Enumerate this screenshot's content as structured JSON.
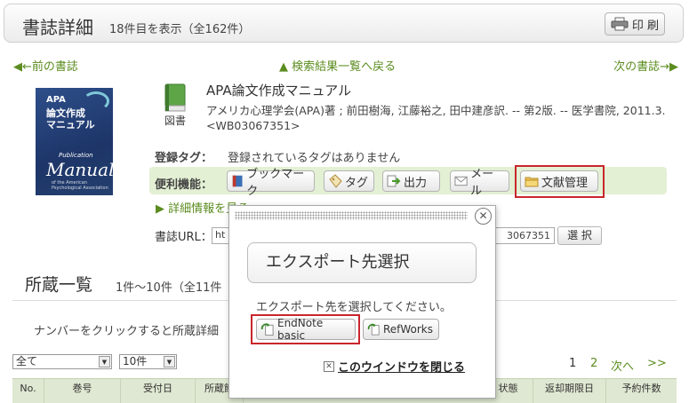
{
  "header": {
    "title": "書誌詳細",
    "count": "18件目を表示（全162件）",
    "print_label": "印 刷"
  },
  "nav": {
    "prev": "◀←前の書誌",
    "back": "▲ 検索結果一覧へ戻る",
    "next": "次の書誌→▶"
  },
  "cover": {
    "line1": "APA",
    "line2": "論文作成",
    "line3": "マニュアル",
    "line4": "Publication",
    "line5": "Manual",
    "line6": "of the American Psychological Association"
  },
  "book": {
    "type_label": "図書",
    "title": "APA論文作成マニュアル",
    "description": "アメリカ心理学会(APA)著 ; 前田樹海, 江藤裕之, 田中建彦訳. -- 第2版. -- 医学書院, 2011.3. <WB03067351>"
  },
  "tags": {
    "label": "登録タグ：",
    "value": "登録されているタグはありません"
  },
  "tools": {
    "label": "便利機能：",
    "bookmark": "ブックマーク",
    "tag": "タグ",
    "output": "出力",
    "mail": "メール",
    "refmgmt": "文献管理"
  },
  "detail_link": "▶ 詳細情報を見る",
  "url": {
    "label": "書誌URL：",
    "value_start": "ht",
    "value_end": "3067351",
    "select": "選 択"
  },
  "holdings": {
    "title": "所蔵一覧",
    "count": "1件～10件（全11件",
    "note": "ナンバーをクリックすると所蔵詳細"
  },
  "filters": {
    "scope": "全て",
    "per_page": "10件"
  },
  "pager": {
    "p1": "1",
    "p2": "2",
    "next": "次へ",
    "last": ">>"
  },
  "table": {
    "columns": [
      "No.",
      "巻号",
      "受付日",
      "所蔵館",
      "状態",
      "返却期限日",
      "予約件数"
    ]
  },
  "popup": {
    "title": "エクスポート先選択",
    "message": "エクスポート先を選択してください。",
    "endnote": "EndNote basic",
    "refworks": "RefWorks",
    "close": "このウインドウを閉じる",
    "close_x": "✕"
  },
  "colors": {
    "link_green": "#5b8c1f",
    "tool_bar_bg": "#e3f0d4",
    "highlight_red": "#c8262c"
  }
}
